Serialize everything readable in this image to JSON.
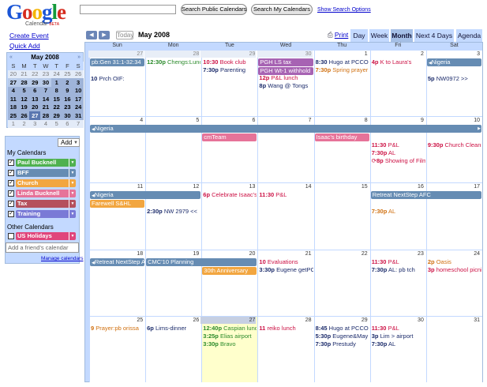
{
  "app": {
    "logo_text": "Google",
    "logo_sub": "Calendar",
    "logo_beta": "BETA"
  },
  "search": {
    "value": "",
    "public_label": "Search Public Calendars",
    "my_label": "Search My Calendars",
    "options_label": "Show Search Options"
  },
  "sidebar": {
    "create_event": "Create Event",
    "quick_add": "Quick Add",
    "mini_cal": {
      "title": "May 2008",
      "prev": "«",
      "next": "»",
      "day_headers": [
        "S",
        "M",
        "T",
        "W",
        "T",
        "F",
        "S"
      ],
      "weeks": [
        [
          "20",
          "21",
          "22",
          "23",
          "24",
          "25",
          "26"
        ],
        [
          "27",
          "28",
          "29",
          "30",
          "1",
          "2",
          "3"
        ],
        [
          "4",
          "5",
          "6",
          "7",
          "8",
          "9",
          "10"
        ],
        [
          "11",
          "12",
          "13",
          "14",
          "15",
          "16",
          "17"
        ],
        [
          "18",
          "19",
          "20",
          "21",
          "22",
          "23",
          "24"
        ],
        [
          "25",
          "26",
          "27",
          "28",
          "29",
          "30",
          "31"
        ],
        [
          "1",
          "2",
          "3",
          "4",
          "5",
          "6",
          "7"
        ]
      ]
    },
    "add_label": "Add",
    "my_calendars_label": "My Calendars",
    "my_calendars": [
      {
        "name": "Paul Bucknell",
        "color": "#4fb14f",
        "checked": true
      },
      {
        "name": "BFF",
        "color": "#668cb3",
        "checked": true
      },
      {
        "name": "Church",
        "color": "#f2a640",
        "checked": true
      },
      {
        "name": "Linda Bucknell",
        "color": "#e67399",
        "checked": true
      },
      {
        "name": "Tax",
        "color": "#b5515d",
        "checked": true
      },
      {
        "name": "Training",
        "color": "#7a7ad6",
        "checked": true
      }
    ],
    "other_calendars_label": "Other Calendars",
    "other_calendars": [
      {
        "name": "US Holidays",
        "color": "#e0457b",
        "checked": false
      }
    ],
    "friend_placeholder": "Add a friend's calendar",
    "manage_label": "Manage calendars"
  },
  "toolbar": {
    "prev": "◀",
    "next": "▶",
    "today_label": "Today",
    "month_title": "May 2008",
    "print_label": "Print",
    "views": [
      "Day",
      "Week",
      "Month",
      "Next 4 Days",
      "Agenda"
    ],
    "active_view": "Month"
  },
  "colors": {
    "blue": "#668cb3",
    "purple": "#a763b3",
    "red": "#d06b64",
    "pink": "#e67399",
    "orange": "#f2a640",
    "dred": "#b5515d",
    "green": "#4fb14f"
  },
  "calendar": {
    "day_headers": [
      "Sun",
      "Mon",
      "Tue",
      "Wed",
      "Thu",
      "Fri",
      "Sat"
    ],
    "weeks": [
      {
        "days": [
          "27",
          "28",
          "29",
          "30",
          "1",
          "2",
          "3"
        ],
        "out": [
          true,
          true,
          true,
          true,
          false,
          false,
          false
        ]
      },
      {
        "days": [
          "4",
          "5",
          "6",
          "7",
          "8",
          "9",
          "10"
        ],
        "out": [
          false,
          false,
          false,
          false,
          false,
          false,
          false
        ]
      },
      {
        "days": [
          "11",
          "12",
          "13",
          "14",
          "15",
          "16",
          "17"
        ],
        "out": [
          false,
          false,
          false,
          false,
          false,
          false,
          false
        ]
      },
      {
        "days": [
          "18",
          "19",
          "20",
          "21",
          "22",
          "23",
          "24"
        ],
        "out": [
          false,
          false,
          false,
          false,
          false,
          false,
          false
        ]
      },
      {
        "days": [
          "25",
          "26",
          "27",
          "28",
          "29",
          "30",
          "31"
        ],
        "out": [
          false,
          false,
          false,
          false,
          false,
          false,
          false
        ]
      }
    ],
    "today_label": "27",
    "bars": [
      {
        "w": 0,
        "c0": 0,
        "c1": 0,
        "row": 0,
        "text": "pb:Gen 31:1-32:34",
        "color": "#668cb3"
      },
      {
        "w": 0,
        "c0": 3,
        "c1": 3,
        "row": 0,
        "text": "PGH LS tax",
        "color": "#a763b3"
      },
      {
        "w": 0,
        "c0": 3,
        "c1": 3,
        "row": 1,
        "text": "PGH Wt-1 withhold",
        "color": "#a763b3"
      },
      {
        "w": 0,
        "c0": 6,
        "c1": 6,
        "row": 0,
        "text": "Nigeria",
        "color": "#668cb3",
        "lead": true
      },
      {
        "w": 1,
        "c0": 0,
        "c1": 6,
        "row": 0,
        "text": "Nigeria",
        "color": "#668cb3",
        "lead": true,
        "trail": true
      },
      {
        "w": 1,
        "c0": 2,
        "c1": 2,
        "row": 1,
        "text": "cmTeam",
        "color": "#e67399"
      },
      {
        "w": 1,
        "c0": 4,
        "c1": 4,
        "row": 1,
        "text": "Isaac's birthday",
        "color": "#e67399"
      },
      {
        "w": 2,
        "c0": 0,
        "c1": 1,
        "row": 0,
        "text": "Nigeria",
        "color": "#668cb3",
        "lead": true
      },
      {
        "w": 2,
        "c0": 5,
        "c1": 6,
        "row": 0,
        "text": "Retreat NextStep AFC",
        "color": "#668cb3"
      },
      {
        "w": 2,
        "c0": 0,
        "c1": 0,
        "row": 1,
        "text": "Farewell S&HL",
        "color": "#f2a640"
      },
      {
        "w": 3,
        "c0": 0,
        "c1": 0,
        "row": 0,
        "text": "Retreat NextStep AFC",
        "color": "#668cb3",
        "lead": true
      },
      {
        "w": 3,
        "c0": 1,
        "c1": 2,
        "row": 0,
        "text": "CMC'10 Planning",
        "color": "#668cb3"
      },
      {
        "w": 3,
        "c0": 2,
        "c1": 2,
        "row": 1,
        "text": "30th Anniversary",
        "color": "#f2a640"
      }
    ],
    "events": [
      {
        "w": 0,
        "c": 0,
        "row": 1,
        "time": "10",
        "text": "Prch OIF:",
        "color": "#1a2a6a"
      },
      {
        "w": 0,
        "c": 1,
        "row": 0,
        "time": "12:30p",
        "text": "Chengs:Lunch",
        "color": "#2a8a2a"
      },
      {
        "w": 0,
        "c": 2,
        "row": 0,
        "time": "10:30",
        "text": "Book club",
        "color": "#cc1144"
      },
      {
        "w": 0,
        "c": 2,
        "row": 1,
        "time": "7:30p",
        "text": "Parenting",
        "color": "#1a2a6a"
      },
      {
        "w": 0,
        "c": 3,
        "row": 2,
        "time": "12p",
        "text": "P&L lunch",
        "color": "#cc1144"
      },
      {
        "w": 0,
        "c": 3,
        "row": 3,
        "time": "8p",
        "text": "Wang @ Tongs",
        "color": "#1a2a6a"
      },
      {
        "w": 0,
        "c": 4,
        "row": 0,
        "time": "8:30",
        "text": "Hugo at PCCO",
        "color": "#1a2a6a"
      },
      {
        "w": 0,
        "c": 4,
        "row": 1,
        "time": "7:30p",
        "text": "Spring prayer",
        "color": "#d07010"
      },
      {
        "w": 0,
        "c": 5,
        "row": 0,
        "time": "4p",
        "text": "K to Laura's",
        "color": "#cc1144"
      },
      {
        "w": 0,
        "c": 6,
        "row": 1,
        "time": "5p",
        "text": "NW0972 >>",
        "color": "#1a2a6a"
      },
      {
        "w": 1,
        "c": 5,
        "row": 1,
        "time": "11:30",
        "text": "P&L",
        "color": "#cc1144"
      },
      {
        "w": 1,
        "c": 5,
        "row": 2,
        "time": "7:30p",
        "text": "AL",
        "color": "#cc1144"
      },
      {
        "w": 1,
        "c": 5,
        "row": 3,
        "time": "8p",
        "text": "Showing of Film",
        "color": "#cc1144",
        "icon": "repeat"
      },
      {
        "w": 1,
        "c": 6,
        "row": 1,
        "time": "9:30p",
        "text": "Church Clean-Up",
        "color": "#cc1144"
      },
      {
        "w": 2,
        "c": 1,
        "row": 1,
        "time": "2:30p",
        "text": "NW 2979 <<",
        "color": "#1a2a6a"
      },
      {
        "w": 2,
        "c": 2,
        "row": 0,
        "time": "6p",
        "text": "Celebrate Isaac's",
        "color": "#cc1144"
      },
      {
        "w": 2,
        "c": 3,
        "row": 0,
        "time": "11:30",
        "text": "P&L",
        "color": "#cc1144"
      },
      {
        "w": 2,
        "c": 5,
        "row": 1,
        "time": "7:30p",
        "text": "AL",
        "color": "#d07010"
      },
      {
        "w": 3,
        "c": 3,
        "row": 0,
        "time": "10",
        "text": "Evaluations",
        "color": "#cc1144"
      },
      {
        "w": 3,
        "c": 3,
        "row": 1,
        "time": "3:30p",
        "text": "Eugene getPCO",
        "color": "#1a2a6a"
      },
      {
        "w": 3,
        "c": 5,
        "row": 0,
        "time": "11:30",
        "text": "P&L",
        "color": "#cc1144"
      },
      {
        "w": 3,
        "c": 5,
        "row": 1,
        "time": "7:30p",
        "text": "AL: pb tch",
        "color": "#1a2a6a"
      },
      {
        "w": 3,
        "c": 6,
        "row": 0,
        "time": "2p",
        "text": "Oasis",
        "color": "#d07010"
      },
      {
        "w": 3,
        "c": 6,
        "row": 1,
        "time": "3p",
        "text": "homeschool picnic",
        "color": "#cc1144"
      },
      {
        "w": 4,
        "c": 0,
        "row": 0,
        "time": "9",
        "text": "Prayer:pb orissa",
        "color": "#d07010"
      },
      {
        "w": 4,
        "c": 1,
        "row": 0,
        "time": "6p",
        "text": "Lims-dinner",
        "color": "#1a2a6a"
      },
      {
        "w": 4,
        "c": 2,
        "row": 0,
        "time": "12:40p",
        "text": "Caspian lunch",
        "color": "#2a8a2a"
      },
      {
        "w": 4,
        "c": 2,
        "row": 1,
        "time": "3:25p",
        "text": "Elias airport",
        "color": "#2a8a2a"
      },
      {
        "w": 4,
        "c": 2,
        "row": 2,
        "time": "3:30p",
        "text": "Bravo",
        "color": "#2a8a2a"
      },
      {
        "w": 4,
        "c": 3,
        "row": 0,
        "time": "11",
        "text": "reiko lunch",
        "color": "#cc1144"
      },
      {
        "w": 4,
        "c": 4,
        "row": 0,
        "time": "8:45",
        "text": "Hugo at PCCO",
        "color": "#1a2a6a"
      },
      {
        "w": 4,
        "c": 4,
        "row": 1,
        "time": "5:30p",
        "text": "Eugene&May",
        "color": "#1a2a6a"
      },
      {
        "w": 4,
        "c": 4,
        "row": 2,
        "time": "7:30p",
        "text": "Prestudy",
        "color": "#1a2a6a"
      },
      {
        "w": 4,
        "c": 5,
        "row": 0,
        "time": "11:30",
        "text": "P&L",
        "color": "#cc1144"
      },
      {
        "w": 4,
        "c": 5,
        "row": 1,
        "time": "3p",
        "text": "Lim > airport",
        "color": "#1a2a6a"
      },
      {
        "w": 4,
        "c": 5,
        "row": 2,
        "time": "7:30p",
        "text": "AL",
        "color": "#1a2a6a"
      }
    ]
  }
}
